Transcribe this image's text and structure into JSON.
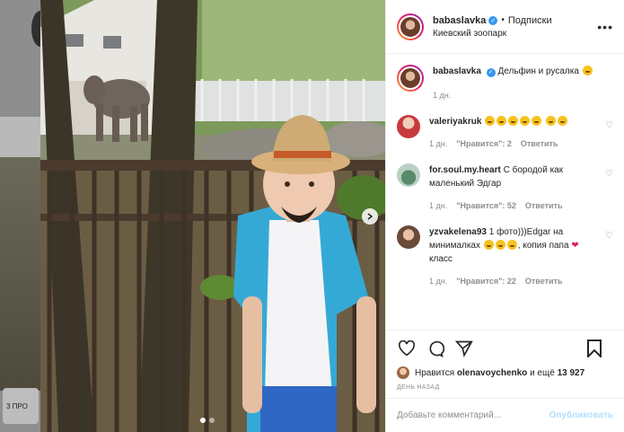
{
  "background": {
    "badge_text": "3 ПРО"
  },
  "post": {
    "author": "babaslavka",
    "follow_label": "Подписки",
    "location": "Киевский зоопарк",
    "more_icon": "more-horizontal-icon",
    "caption": {
      "author": "babaslavka",
      "text": "Дельфин и русалка",
      "time": "1 дн."
    },
    "comments": [
      {
        "user": "valeriyakruk",
        "text": "",
        "emoji_count": 7,
        "time": "1 дн.",
        "likes": "\"Нравится\": 2",
        "reply": "Ответить"
      },
      {
        "user": "for.soul.my.heart",
        "text": "С бородой как маленький Эдгар",
        "time": "1 дн.",
        "likes": "\"Нравится\": 52",
        "reply": "Ответить"
      },
      {
        "user": "yzvakelena93",
        "text_a": "1 фото)))Edgar на минималках",
        "text_b": ", копия папа",
        "text_c": "класс",
        "time": "1 дн.",
        "likes": "\"Нравится\": 22",
        "reply": "Ответить"
      }
    ],
    "likes_prefix": "Нравится",
    "likes_user": "olenavoychenko",
    "likes_suffix": "и ещё",
    "likes_count": "13 927",
    "ago": "ДЕНЬ НАЗАД",
    "add_comment_placeholder": "Добавьте комментарий...",
    "publish_label": "Опубликовать"
  },
  "colors": {
    "accent": "#3897f0",
    "publish": "#b2dffc"
  }
}
